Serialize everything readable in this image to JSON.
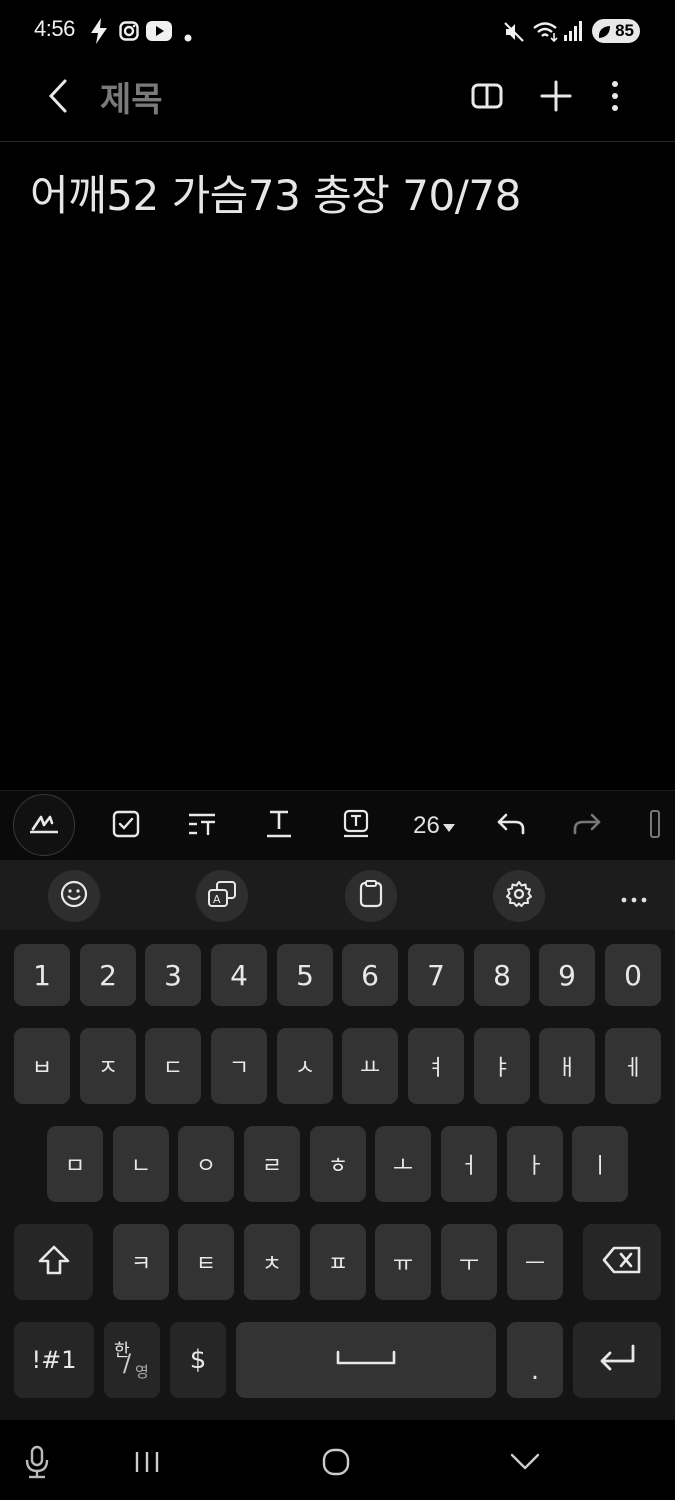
{
  "status_bar": {
    "time": "4:56",
    "battery": "85"
  },
  "app_bar": {
    "title": "제목",
    "icons": [
      "back-icon",
      "reading-mode-icon",
      "add-icon",
      "more-options-icon"
    ]
  },
  "note": {
    "content": "어깨52 가슴73 총장 70/78"
  },
  "format_toolbar": {
    "font_size": "26",
    "items": [
      "pen-icon",
      "checklist-icon",
      "text-style-icon",
      "underline-text-icon",
      "text-box-icon",
      "font-size",
      "undo-icon",
      "redo-icon"
    ]
  },
  "keyboard": {
    "toolbar_items": [
      "emoji-icon",
      "translate-icon",
      "clipboard-icon",
      "settings-icon",
      "more-icon"
    ],
    "row_numbers": [
      "1",
      "2",
      "3",
      "4",
      "5",
      "6",
      "7",
      "8",
      "9",
      "0"
    ],
    "row1": [
      "ㅂ",
      "ㅈ",
      "ㄷ",
      "ㄱ",
      "ㅅ",
      "ㅛ",
      "ㅕ",
      "ㅑ",
      "ㅐ",
      "ㅔ"
    ],
    "row2": [
      "ㅁ",
      "ㄴ",
      "ㅇ",
      "ㄹ",
      "ㅎ",
      "ㅗ",
      "ㅓ",
      "ㅏ",
      "ㅣ"
    ],
    "row3": [
      "ㅋ",
      "ㅌ",
      "ㅊ",
      "ㅍ",
      "ㅠ",
      "ㅜ",
      "ㅡ"
    ],
    "symbols_key": "!#1",
    "lang_key_top": "한",
    "lang_key_bottom": "영",
    "dollar_key": "$",
    "period_key": "."
  },
  "colors": {
    "background": "#000000",
    "key": "#333333",
    "keyboard": "#141414",
    "title_placeholder": "#7a7a7a"
  }
}
